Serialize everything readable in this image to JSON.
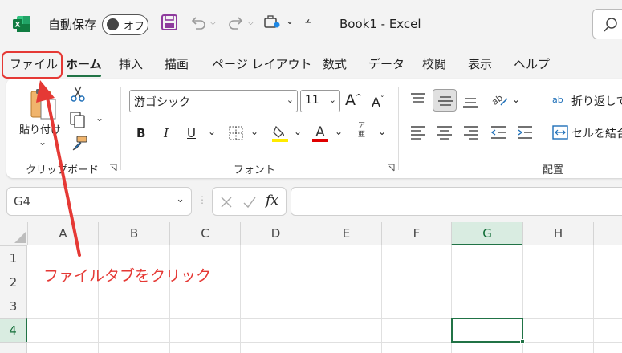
{
  "titlebar": {
    "autosave_label": "自動保存",
    "autosave_state": "オフ",
    "book_title": "Book1  -  Excel"
  },
  "tabs": [
    {
      "label": "ファイル"
    },
    {
      "label": "ホーム"
    },
    {
      "label": "挿入"
    },
    {
      "label": "描画"
    },
    {
      "label": "ページ レイアウト"
    },
    {
      "label": "数式"
    },
    {
      "label": "データ"
    },
    {
      "label": "校閲"
    },
    {
      "label": "表示"
    },
    {
      "label": "ヘルプ"
    }
  ],
  "ribbon": {
    "clipboard": {
      "paste_label": "貼り付け",
      "group_label": "クリップボード"
    },
    "font": {
      "font_name": "游ゴシック",
      "font_size": "11",
      "group_label": "フォント",
      "bold": "B",
      "italic": "I",
      "underline": "U",
      "phonetic_top": "ア",
      "phonetic_bottom": "亜"
    },
    "alignment": {
      "wrap_label": "折り返して",
      "merge_label": "セルを結合",
      "group_label": "配置",
      "wrap_icon_text": "ab"
    }
  },
  "formula_bar": {
    "name_box": "G4",
    "fx_label": "fx",
    "formula_value": ""
  },
  "grid": {
    "columns": [
      "A",
      "B",
      "C",
      "D",
      "E",
      "F",
      "G",
      "H"
    ],
    "rows": [
      "1",
      "2",
      "3",
      "4"
    ],
    "selected_column": "G",
    "selected_row": "4"
  },
  "annotation": {
    "callout_text": "ファイルタブをクリック"
  },
  "colors": {
    "excel_green": "#217346",
    "highlight_red": "#e53935",
    "font_color_red": "#e00000",
    "highlight_yellow": "#ffeb00"
  },
  "icons": [
    "excel-logo-icon",
    "save-icon",
    "undo-icon",
    "redo-icon",
    "customize-icon",
    "search-icon",
    "paste-icon",
    "cut-icon",
    "copy-icon",
    "format-painter-icon",
    "font-grow-icon",
    "font-shrink-icon",
    "border-icon",
    "fill-color-icon",
    "font-color-icon",
    "cancel-icon",
    "enter-icon"
  ]
}
